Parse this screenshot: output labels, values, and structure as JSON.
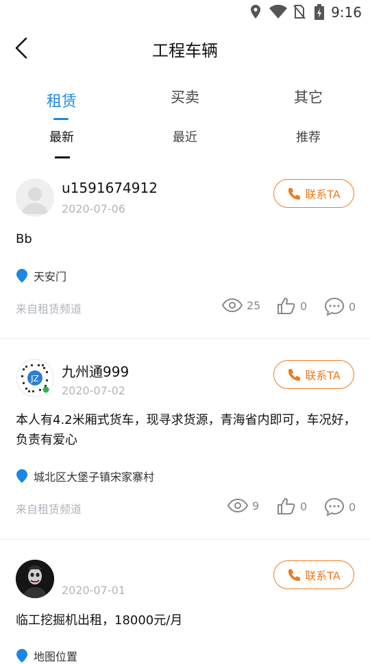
{
  "status_bar": {
    "time": "9:16"
  },
  "header": {
    "title": "工程车辆"
  },
  "tabs": [
    "租赁",
    "买卖",
    "其它"
  ],
  "subtabs": [
    "最新",
    "最近",
    "推荐"
  ],
  "posts": [
    {
      "username": "u1591674912",
      "date": "2020-07-06",
      "contact_label": "联系TA",
      "content": "Bb",
      "location": "天安门",
      "source": "来自租赁频道",
      "views": "25",
      "likes": "0",
      "comments": "0"
    },
    {
      "username": "九州通999",
      "date": "2020-07-02",
      "contact_label": "联系TA",
      "content": "本人有4.2米厢式货车，现寻求货源，青海省内即可，车况好，负责有爱心",
      "location": "城北区大堡子镇宋家寨村",
      "source": "来自租赁频道",
      "views": "9",
      "likes": "0",
      "comments": "0"
    },
    {
      "username": "",
      "date": "2020-07-01",
      "contact_label": "联系TA",
      "content": "临工挖掘机出租，18000元/月",
      "location": "地图位置"
    }
  ],
  "colors": {
    "accent": "#1a86e6",
    "contact": "#f07a1c",
    "muted": "#b0b4bb"
  }
}
